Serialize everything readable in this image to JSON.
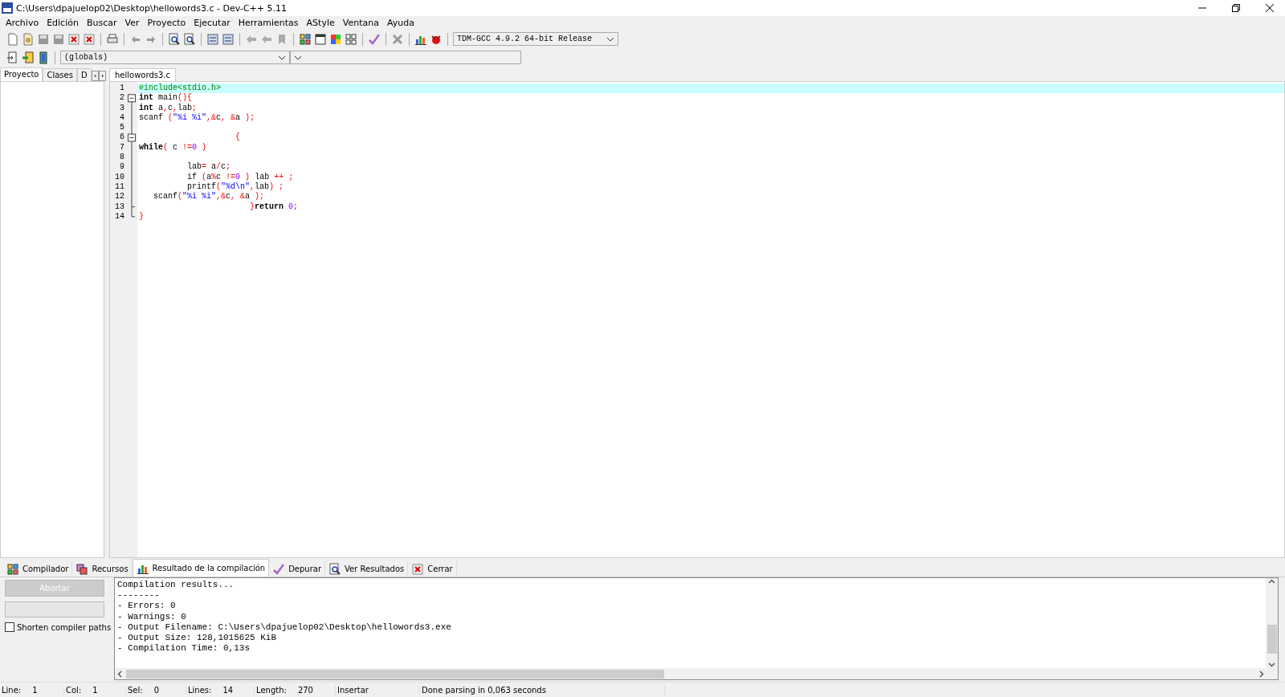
{
  "window": {
    "title": "C:\\Users\\dpajuelop02\\Desktop\\hellowords3.c - Dev-C++ 5.11"
  },
  "menu": [
    "Archivo",
    "Edición",
    "Buscar",
    "Ver",
    "Proyecto",
    "Ejecutar",
    "Herramientas",
    "AStyle",
    "Ventana",
    "Ayuda"
  ],
  "compiler_select": {
    "value": "TDM-GCC 4.9.2 64-bit Release"
  },
  "scope_select": {
    "value": "(globals)"
  },
  "left_tabs": [
    {
      "label": "Proyecto",
      "selected": true
    },
    {
      "label": "Clases",
      "selected": false
    },
    {
      "label": "D",
      "selected": false
    }
  ],
  "editor": {
    "tabs": [
      {
        "label": "hellowords3.c",
        "selected": true
      }
    ],
    "lines": [
      {
        "number": "1",
        "foldable": false,
        "current": true,
        "tokens": [
          {
            "kind": "pre",
            "text": "#include<stdio.h>"
          }
        ]
      },
      {
        "number": "2",
        "foldable": true,
        "current": false,
        "tokens": [
          {
            "kind": "kw",
            "text": "int"
          },
          {
            "kind": "id",
            "text": " main"
          },
          {
            "kind": "sym",
            "text": "(){"
          }
        ]
      },
      {
        "number": "3",
        "foldable": false,
        "current": false,
        "tokens": [
          {
            "kind": "kw",
            "text": "int"
          },
          {
            "kind": "id",
            "text": " a"
          },
          {
            "kind": "sym",
            "text": ","
          },
          {
            "kind": "id",
            "text": "c"
          },
          {
            "kind": "sym",
            "text": ","
          },
          {
            "kind": "id",
            "text": "lab"
          },
          {
            "kind": "sym",
            "text": ";"
          }
        ]
      },
      {
        "number": "4",
        "foldable": false,
        "current": false,
        "tokens": [
          {
            "kind": "id",
            "text": "scanf "
          },
          {
            "kind": "sym",
            "text": "("
          },
          {
            "kind": "str",
            "text": "\"%i %i\""
          },
          {
            "kind": "sym",
            "text": ",&"
          },
          {
            "kind": "id",
            "text": "c"
          },
          {
            "kind": "sym",
            "text": ", &"
          },
          {
            "kind": "id",
            "text": "a "
          },
          {
            "kind": "sym",
            "text": ");"
          }
        ]
      },
      {
        "number": "5",
        "foldable": false,
        "current": false
      },
      {
        "number": "6",
        "foldable": true,
        "current": false,
        "tokens": [
          {
            "kind": "sym",
            "text": "                    {"
          }
        ]
      },
      {
        "number": "7",
        "foldable": false,
        "current": false,
        "tokens": [
          {
            "kind": "kw",
            "text": "while"
          },
          {
            "kind": "sym",
            "text": "("
          },
          {
            "kind": "id",
            "text": " c "
          },
          {
            "kind": "sym",
            "text": "!="
          },
          {
            "kind": "num",
            "text": "0"
          },
          {
            "kind": "sym",
            "text": " )"
          }
        ]
      },
      {
        "number": "8",
        "foldable": false,
        "current": false
      },
      {
        "number": "9",
        "foldable": false,
        "current": false,
        "tokens": [
          {
            "kind": "id",
            "text": "          lab"
          },
          {
            "kind": "sym",
            "text": "="
          },
          {
            "kind": "id",
            "text": " a"
          },
          {
            "kind": "sym",
            "text": "/"
          },
          {
            "kind": "id",
            "text": "c"
          },
          {
            "kind": "sym",
            "text": ";"
          }
        ]
      },
      {
        "number": "10",
        "foldable": false,
        "current": false,
        "tokens": [
          {
            "kind": "id",
            "text": "          if "
          },
          {
            "kind": "sym",
            "text": "("
          },
          {
            "kind": "id",
            "text": "a"
          },
          {
            "kind": "sym",
            "text": "%"
          },
          {
            "kind": "id",
            "text": "c "
          },
          {
            "kind": "sym",
            "text": "!="
          },
          {
            "kind": "num",
            "text": "0"
          },
          {
            "kind": "sym",
            "text": " )"
          },
          {
            "kind": "id",
            "text": " lab "
          },
          {
            "kind": "sym",
            "text": "++ ;"
          }
        ]
      },
      {
        "number": "11",
        "foldable": false,
        "current": false,
        "tokens": [
          {
            "kind": "id",
            "text": "          printf"
          },
          {
            "kind": "sym",
            "text": "("
          },
          {
            "kind": "str",
            "text": "\"%d\\n\""
          },
          {
            "kind": "sym",
            "text": ","
          },
          {
            "kind": "id",
            "text": "lab"
          },
          {
            "kind": "sym",
            "text": ") ;"
          }
        ]
      },
      {
        "number": "12",
        "foldable": false,
        "current": false,
        "tokens": [
          {
            "kind": "id",
            "text": "   scanf"
          },
          {
            "kind": "sym",
            "text": "("
          },
          {
            "kind": "str",
            "text": "\"%i %i\""
          },
          {
            "kind": "sym",
            "text": ",&"
          },
          {
            "kind": "id",
            "text": "c"
          },
          {
            "kind": "sym",
            "text": ", &"
          },
          {
            "kind": "id",
            "text": "a "
          },
          {
            "kind": "sym",
            "text": ");"
          }
        ]
      },
      {
        "number": "13",
        "foldable": false,
        "current": false,
        "tokens": [
          {
            "kind": "sym",
            "text": "                       }"
          },
          {
            "kind": "kw",
            "text": "return"
          },
          {
            "kind": "num",
            "text": " 0"
          },
          {
            "kind": "sym",
            "text": ";"
          }
        ]
      },
      {
        "number": "14",
        "foldable": false,
        "current": false,
        "tokens": [
          {
            "kind": "sym",
            "text": "}"
          }
        ]
      }
    ]
  },
  "bottom_tabs": [
    {
      "label": "Compilador",
      "selected": false
    },
    {
      "label": "Recursos",
      "selected": false
    },
    {
      "label": "Resultado de la compilación",
      "selected": true
    },
    {
      "label": "Depurar",
      "selected": false
    },
    {
      "label": "Ver Resultados",
      "selected": false
    },
    {
      "label": "Cerrar",
      "selected": false
    }
  ],
  "abort_button": {
    "label": "Abortar",
    "disabled": true
  },
  "shorten_paths": {
    "label": "Shorten compiler paths",
    "checked": false
  },
  "output": {
    "lines": [
      "Compilation results...",
      "--------",
      "- Errors: 0",
      "- Warnings: 0",
      "- Output Filename: C:\\Users\\dpajuelop02\\Desktop\\hellowords3.exe",
      "- Output Size: 128,1015625 KiB",
      "- Compilation Time: 0,13s"
    ]
  },
  "status_bar": [
    {
      "label": "Line:",
      "value": "1"
    },
    {
      "label": "Col:",
      "value": "1"
    },
    {
      "label": "Sel:",
      "value": "0"
    },
    {
      "label": "Lines:",
      "value": "14"
    },
    {
      "label": "Length:",
      "value": "270"
    },
    {
      "value": "Insertar"
    },
    {
      "value": "Done parsing in 0,063 seconds"
    }
  ]
}
